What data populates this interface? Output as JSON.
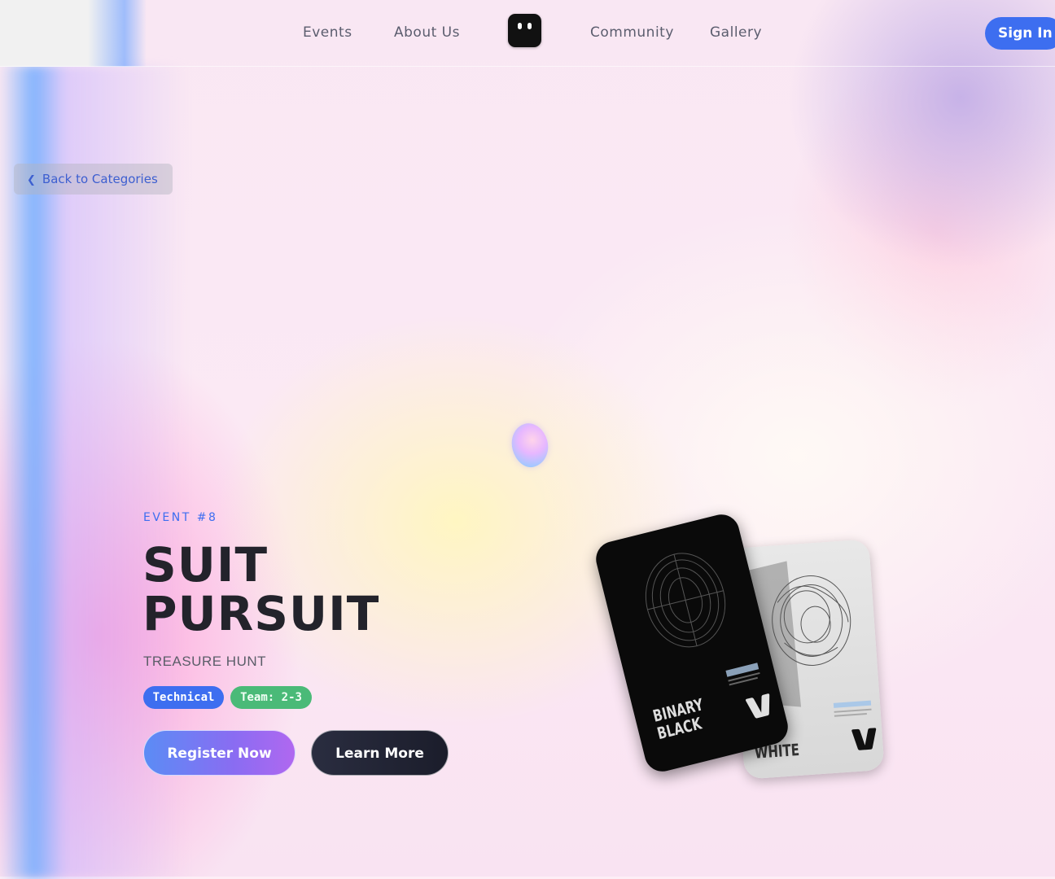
{
  "nav": {
    "links": [
      "Events",
      "About Us",
      "Community",
      "Gallery"
    ],
    "logo_icon": "robot-face-icon",
    "signin_label": "Sign In"
  },
  "back": {
    "label": "Back to Categories",
    "icon": "chevron-left-icon"
  },
  "event": {
    "number_label": "EVENT #8",
    "title_line1": "SUIT",
    "title_line2": "PURSUIT",
    "subtitle": "TREASURE HUNT",
    "tags": [
      "Technical",
      "Team: 2-3"
    ]
  },
  "actions": {
    "register_label": "Register Now",
    "learn_label": "Learn More"
  },
  "cards": {
    "black_label": "BINARY BLACK",
    "white_label": "WHITE"
  },
  "colors": {
    "accent": "#3d6ef0",
    "tag_team": "#4aba78",
    "title_text": "#23232b"
  }
}
